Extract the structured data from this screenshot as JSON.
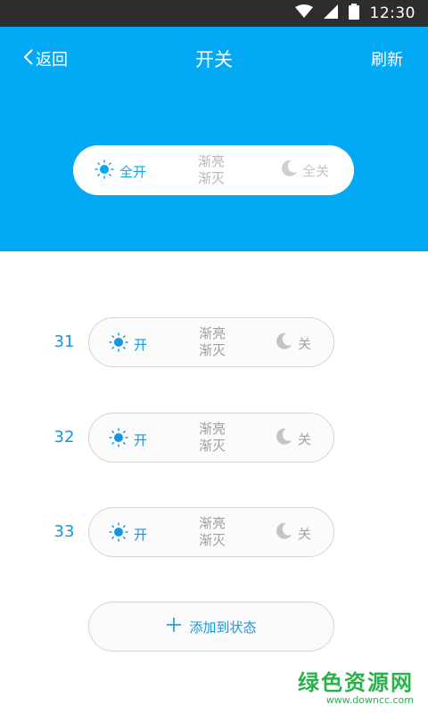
{
  "status_bar": {
    "time": "12:30",
    "icons": [
      "wifi-icon",
      "signal-icon",
      "battery-icon"
    ]
  },
  "nav": {
    "back_label": "返回",
    "title": "开关",
    "refresh_label": "刷新"
  },
  "master": {
    "on_label": "全开",
    "fade_line1": "渐亮",
    "fade_line2": "渐灭",
    "off_label": "全关"
  },
  "rows": [
    {
      "number": "31",
      "on_label": "开",
      "fade_line1": "渐亮",
      "fade_line2": "渐灭",
      "off_label": "关"
    },
    {
      "number": "32",
      "on_label": "开",
      "fade_line1": "渐亮",
      "fade_line2": "渐灭",
      "off_label": "关"
    },
    {
      "number": "33",
      "on_label": "开",
      "fade_line1": "渐亮",
      "fade_line2": "渐灭",
      "off_label": "关"
    }
  ],
  "add_button": {
    "label": "添加到状态"
  },
  "watermark": {
    "text": "绿色资源网",
    "url": "www.downcc.com"
  },
  "colors": {
    "accent": "#03a9f4",
    "row_accent": "#1596e0",
    "muted": "#a5a5a5",
    "watermark": "#29b34a"
  }
}
